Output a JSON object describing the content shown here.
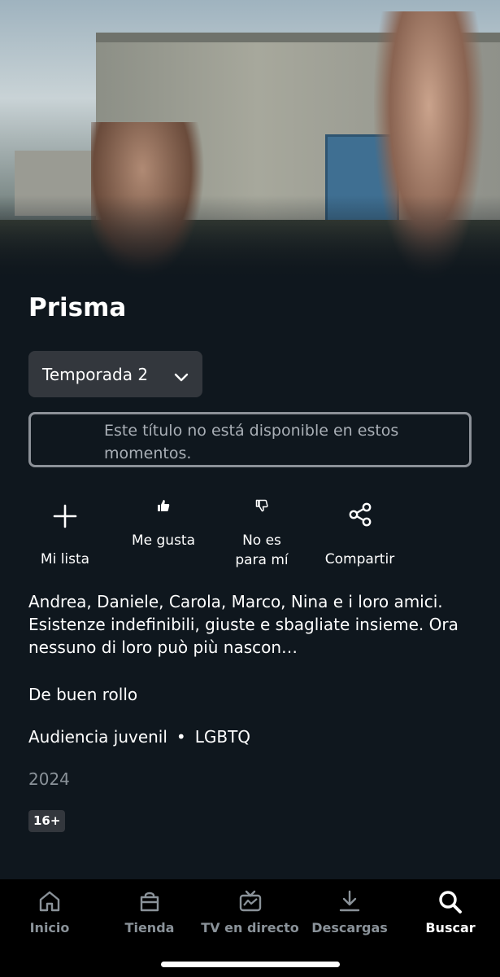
{
  "show": {
    "title": "Prisma",
    "season_label": "Temporada 2",
    "unavailable_notice": "Este título no está disponible en estos momentos.",
    "description": "Andrea, Daniele, Carola, Marco, Nina e i loro amici. Esistenze indefinibili, giuste e sbagliate insieme. Ora nessuno di loro può più nascon…",
    "mood": "De buen rollo",
    "tags": [
      "Audiencia juvenil",
      "LGBTQ"
    ],
    "tag_separator": "•",
    "year": "2024",
    "age_rating": "16+"
  },
  "actions": {
    "add_list": "Mi lista",
    "like": "Me gusta",
    "dislike_line1": "No es",
    "dislike_line2": "para mí",
    "share": "Compartir"
  },
  "nav": {
    "items": [
      {
        "label": "Inicio",
        "icon": "home-icon"
      },
      {
        "label": "Tienda",
        "icon": "shopping-bag-icon"
      },
      {
        "label": "TV en directo",
        "icon": "live-tv-icon"
      },
      {
        "label": "Descargas",
        "icon": "download-icon"
      },
      {
        "label": "Buscar",
        "icon": "search-icon"
      }
    ],
    "active": "Buscar"
  },
  "colors": {
    "background": "#0f171e",
    "navbar": "#000000",
    "button_bg": "#33373d",
    "muted_text": "#8a9299"
  }
}
